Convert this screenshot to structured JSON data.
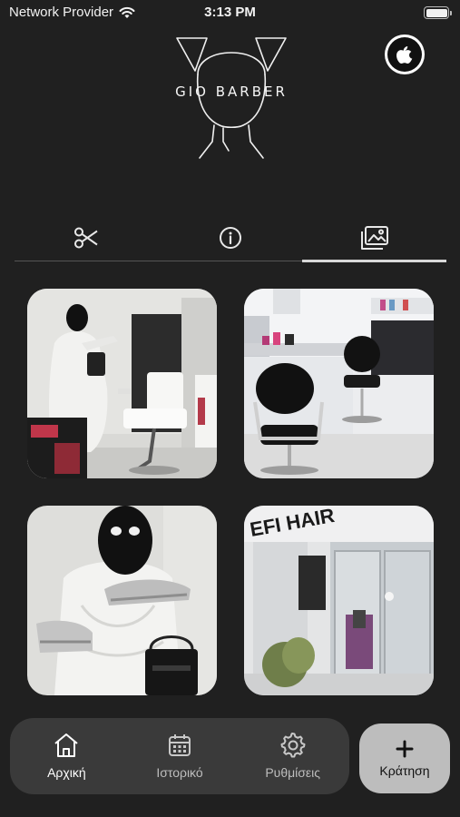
{
  "status_bar": {
    "carrier": "Network Provider",
    "time": "3:13 PM",
    "battery_level": 1.0
  },
  "header": {
    "logo_text": "GIO BARBER",
    "apple_button_icon": "apple-icon"
  },
  "tabs": [
    {
      "icon": "scissors-icon",
      "active": false
    },
    {
      "icon": "info-icon",
      "active": false
    },
    {
      "icon": "gallery-icon",
      "active": true
    }
  ],
  "gallery": {
    "photos": [
      {
        "id": 1,
        "subject": "statue with balaclava and barber chair"
      },
      {
        "id": 2,
        "subject": "salon interior with black chairs"
      },
      {
        "id": 3,
        "subject": "statue with balaclava holding sneakers"
      },
      {
        "id": 4,
        "subject": "salon storefront with glass doors"
      }
    ],
    "storefront_sign": "EFI HAIR"
  },
  "bottom_nav": {
    "items": [
      {
        "label": "Αρχική",
        "icon": "home-icon",
        "active": true
      },
      {
        "label": "Ιστορικό",
        "icon": "calendar-icon",
        "active": false
      },
      {
        "label": "Ρυθμίσεις",
        "icon": "gear-icon",
        "active": false
      }
    ],
    "book_button": {
      "label": "Κράτηση",
      "icon": "plus-icon"
    }
  },
  "colors": {
    "background": "#202020",
    "nav_background": "#3a3a3a",
    "book_button": "#bdbdbd"
  }
}
